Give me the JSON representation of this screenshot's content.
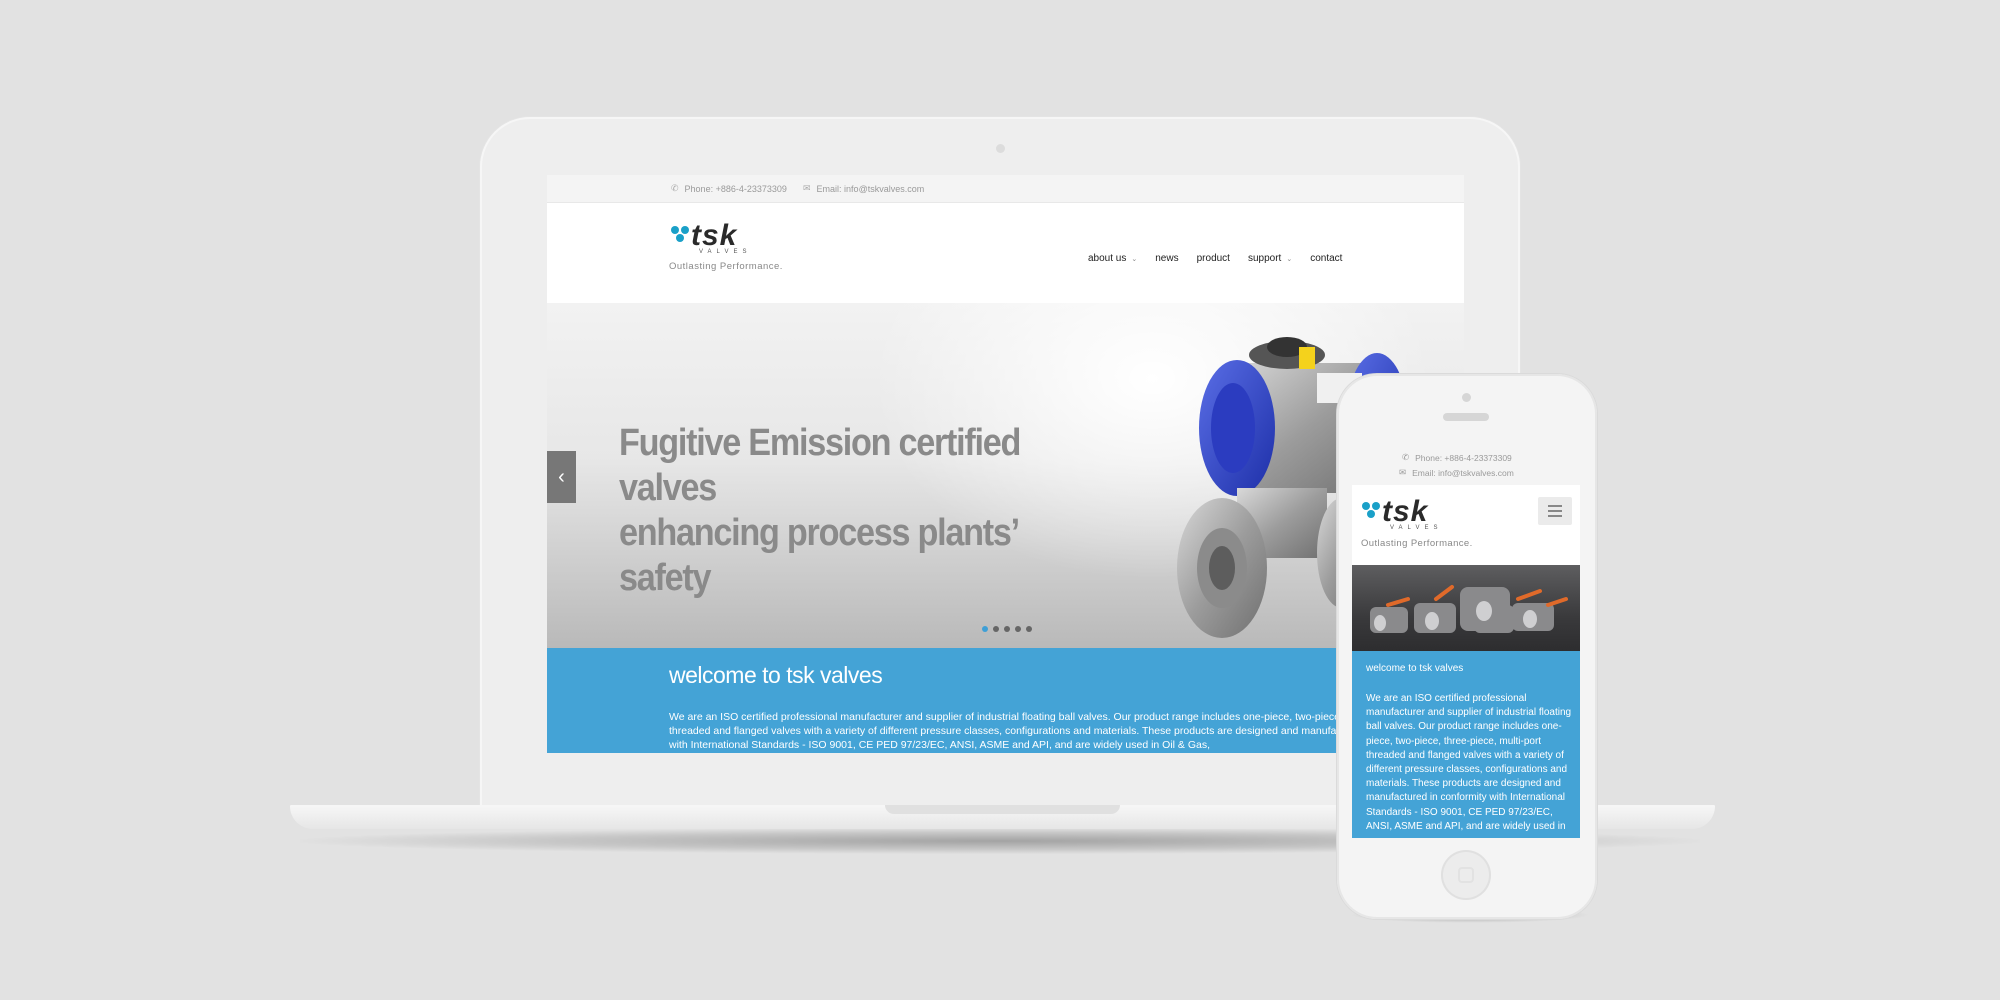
{
  "colors": {
    "background": "#e2e2e2",
    "accent_blue": "#44a3d6",
    "logo_dots": "#1aa0c8",
    "hero_text": "#8a8a8a"
  },
  "desktop": {
    "contact": {
      "phone": "Phone: +886-4-23373309",
      "email": "Email: info@tskvalves.com",
      "phone_icon": "phone-icon",
      "email_icon": "envelope-icon"
    },
    "logo": {
      "brand": "tsk",
      "sub": "VALVES",
      "tagline": "Outlasting Performance."
    },
    "nav": {
      "about": "about us",
      "news": "news",
      "product": "product",
      "support": "support",
      "contact": "contact"
    },
    "hero": {
      "line1": "Fugitive Emission certified valves",
      "line2": "enhancing process plants’ safety",
      "prev_icon": "chevron-left-icon",
      "slides": 5,
      "active_slide": 1
    },
    "welcome": {
      "title": "welcome to tsk valves",
      "body": "We are an ISO certified professional manufacturer and supplier of industrial floating ball valves. Our product range includes one-piece, two-piece, three-piece, multi-port threaded and flanged valves with a variety of different pressure classes, configurations and materials. These products are designed and manufactured in conformity with International Standards - ISO 9001, CE PED 97/23/EC, ANSI, ASME and API, and are widely used in Oil & Gas,"
    }
  },
  "mobile": {
    "contact": {
      "phone": "Phone: +886-4-23373309",
      "email": "Email: info@tskvalves.com"
    },
    "logo": {
      "brand": "tsk",
      "sub": "VALVES",
      "tagline": "Outlasting Performance."
    },
    "menu_icon": "hamburger-icon",
    "welcome": {
      "title": "welcome to tsk valves",
      "body": "We are an ISO certified professional manufacturer and supplier of industrial floating ball valves. Our product range includes one-piece, two-piece, three-piece, multi-port threaded and flanged valves with a variety of different pressure classes, configurations and materials. These products are designed and manufactured in conformity with International Standards - ISO 9001, CE PED 97/23/EC, ANSI, ASME and API, and are widely used in"
    }
  }
}
